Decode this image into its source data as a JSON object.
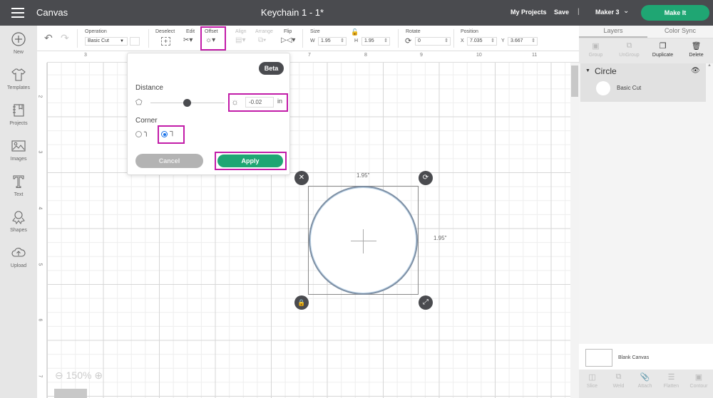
{
  "topbar": {
    "app_title": "Canvas",
    "doc_title": "Keychain 1 - 1*",
    "my_projects": "My Projects",
    "save": "Save",
    "separator": "|",
    "machine": "Maker 3",
    "make_it": "Make It"
  },
  "leftbar": {
    "items": [
      {
        "label": "New",
        "icon": "plus-circle-icon"
      },
      {
        "label": "Templates",
        "icon": "shirt-icon"
      },
      {
        "label": "Projects",
        "icon": "notebook-icon"
      },
      {
        "label": "Images",
        "icon": "image-icon"
      },
      {
        "label": "Text",
        "icon": "text-icon"
      },
      {
        "label": "Shapes",
        "icon": "shapes-icon"
      },
      {
        "label": "Upload",
        "icon": "cloud-upload-icon"
      }
    ]
  },
  "toolbar": {
    "operation_label": "Operation",
    "operation_value": "Basic Cut",
    "deselect_label": "Deselect",
    "edit_label": "Edit",
    "offset_label": "Offset",
    "align_label": "Align",
    "arrange_label": "Arrange",
    "flip_label": "Flip",
    "size_label": "Size",
    "w_label": "W",
    "w_value": "1.95",
    "h_label": "H",
    "h_value": "1.95",
    "rotate_label": "Rotate",
    "rotate_value": "0",
    "position_label": "Position",
    "x_label": "X",
    "x_value": "7.035",
    "y_label": "Y",
    "y_value": "3.667"
  },
  "canvas": {
    "h_ruler": [
      "3",
      "7",
      "8",
      "9",
      "10",
      "11"
    ],
    "v_ruler": [
      "2",
      "3",
      "4",
      "5",
      "6",
      "7"
    ],
    "zoom_level": "150%",
    "width_label": "1.95\"",
    "height_label": "1.95\""
  },
  "offset_popup": {
    "badge": "Beta",
    "distance_label": "Distance",
    "distance_value": "-0.02",
    "distance_unit": "in",
    "corner_label": "Corner",
    "corner_selected": "square",
    "cancel": "Cancel",
    "apply": "Apply"
  },
  "right_panel": {
    "tabs": [
      "Layers",
      "Color Sync"
    ],
    "active_tab": "Layers",
    "actions": [
      {
        "label": "Group",
        "enabled": false
      },
      {
        "label": "UnGroup",
        "enabled": false
      },
      {
        "label": "Duplicate",
        "enabled": true
      },
      {
        "label": "Delete",
        "enabled": true
      }
    ],
    "layer": {
      "name": "Circle",
      "operation": "Basic Cut"
    },
    "canvas_label": "Blank Canvas",
    "bottom_actions": [
      "Slice",
      "Weld",
      "Attach",
      "Flatten",
      "Contour"
    ]
  },
  "colors": {
    "topbar": "#4a4b4f",
    "accent_green": "#1fa673",
    "highlight": "#c21ca8"
  }
}
